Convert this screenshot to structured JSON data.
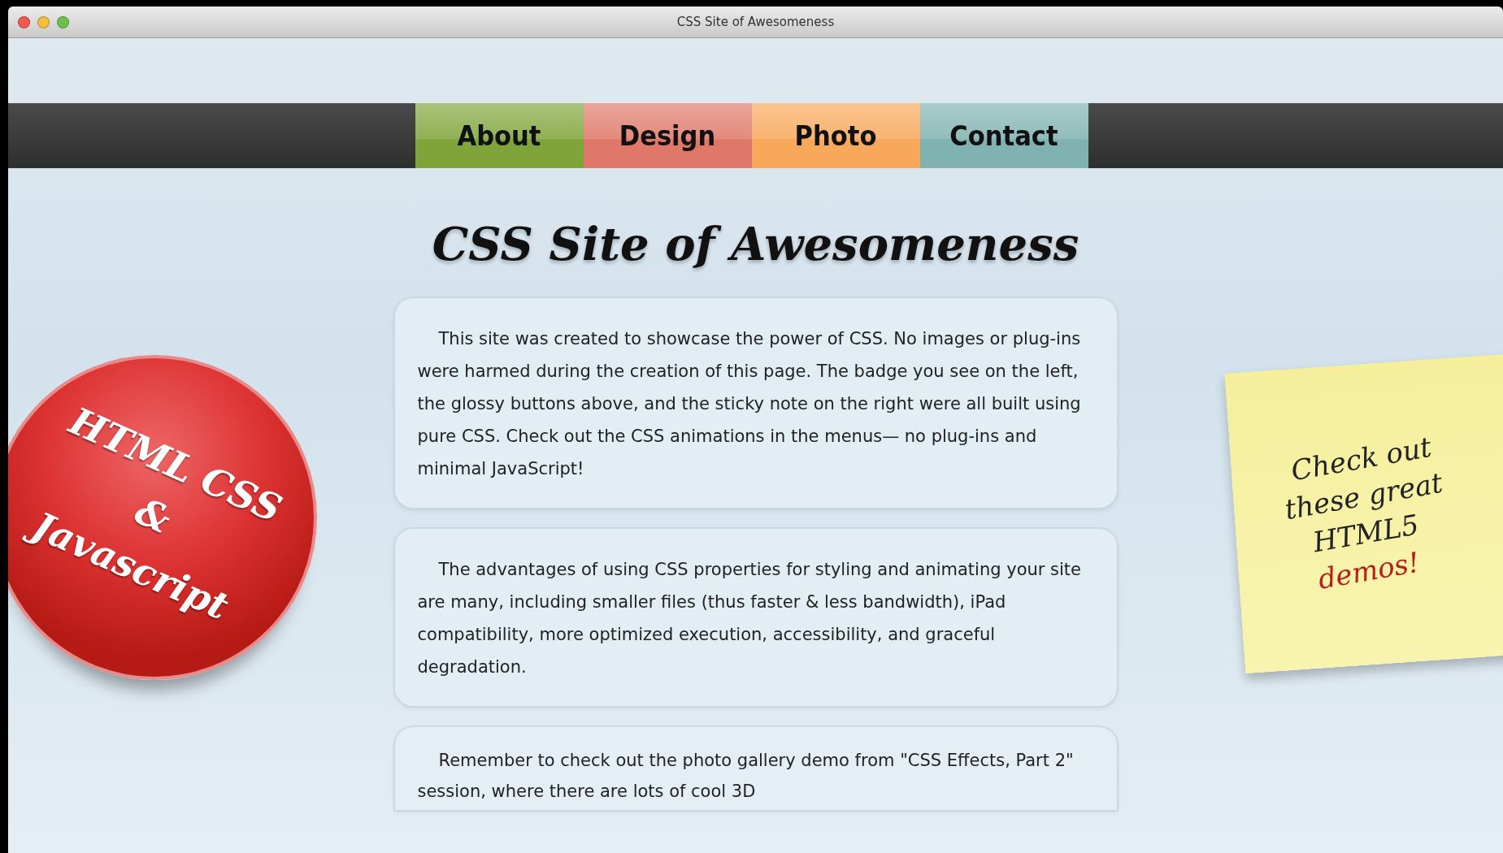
{
  "window": {
    "title": "CSS Site of Awesomeness"
  },
  "nav": [
    {
      "label": "About",
      "color": "#7fa53a"
    },
    {
      "label": "Design",
      "color": "#e0786a"
    },
    {
      "label": "Photo",
      "color": "#f8a85a"
    },
    {
      "label": "Contact",
      "color": "#7fb2b0"
    }
  ],
  "heading": "CSS Site of Awesomeness",
  "badge": {
    "lines": [
      "HTML CSS",
      "&",
      "Javascript"
    ]
  },
  "cards": [
    "This site was created to showcase the power of CSS. No images or plug-ins were harmed during the creation of this page. The badge you see on the left, the glossy buttons above, and the sticky note on the right were all built using pure CSS. Check out the CSS animations in the menus— no plug-ins and minimal JavaScript!",
    "The advantages of using CSS properties for styling and animating your site are many, including smaller files (thus faster & less bandwidth), iPad compatibility, more optimized execution, accessibility, and graceful degradation.",
    "Remember to check out the photo gallery demo from \"CSS Effects, Part 2\" session, where there are lots of cool 3D"
  ],
  "sticky_note": {
    "lines": [
      {
        "text": "Check out",
        "kind": "plain"
      },
      {
        "text": "these great",
        "kind": "plain"
      },
      {
        "text": "HTML5",
        "kind": "plain"
      },
      {
        "text": "demos!",
        "kind": "emphasis"
      }
    ]
  }
}
